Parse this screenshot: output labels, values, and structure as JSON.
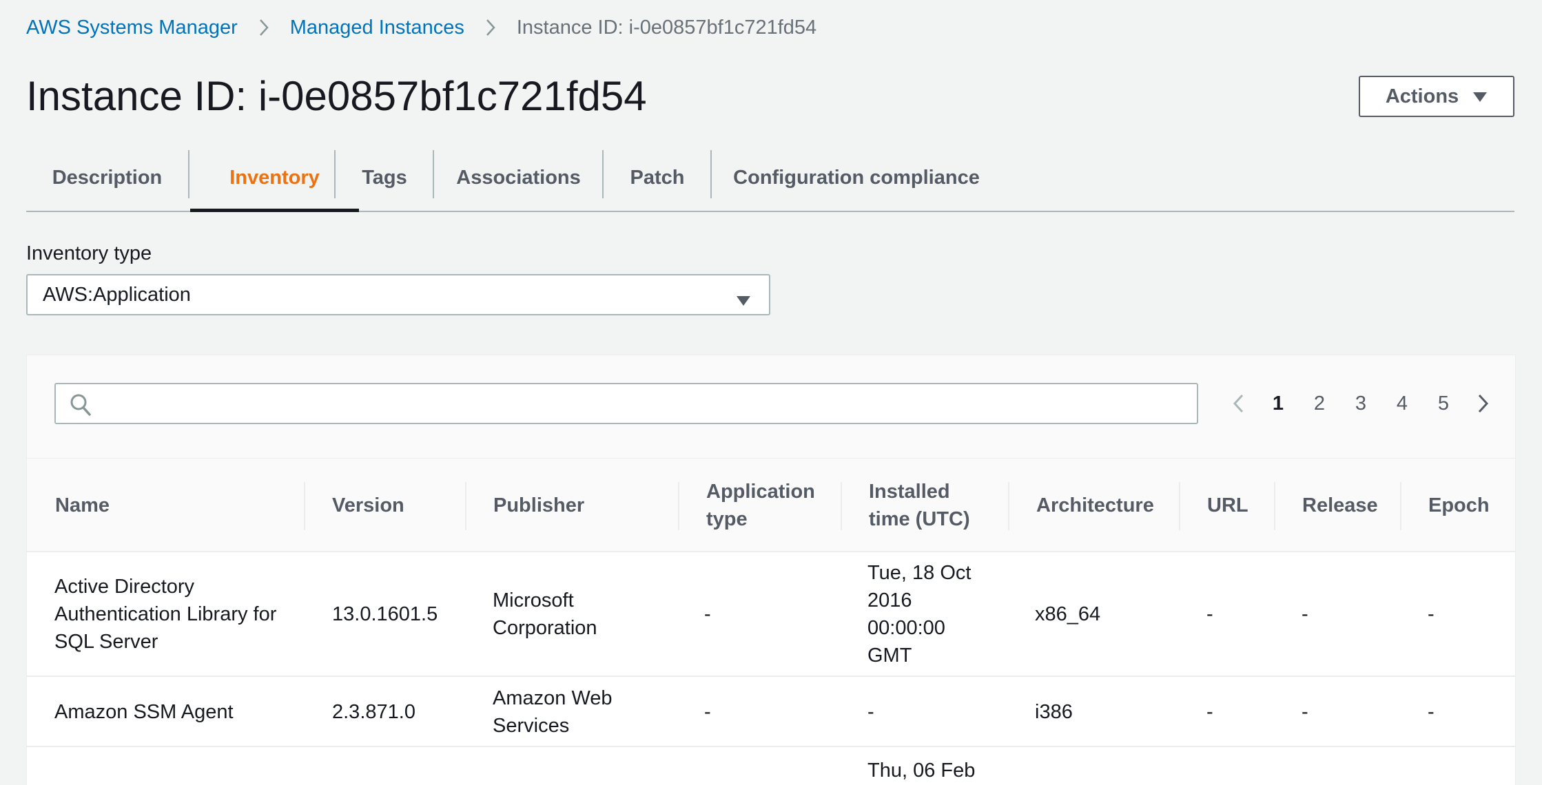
{
  "breadcrumb": {
    "items": [
      "AWS Systems Manager",
      "Managed Instances"
    ],
    "current": "Instance ID: i-0e0857bf1c721fd54"
  },
  "page": {
    "title": "Instance ID: i-0e0857bf1c721fd54",
    "actions_label": "Actions"
  },
  "tabs": [
    "Description",
    "Inventory",
    "Tags",
    "Associations",
    "Patch",
    "Configuration compliance"
  ],
  "active_tab": "Inventory",
  "inventory": {
    "label": "Inventory type",
    "selected": "AWS:Application"
  },
  "search": {
    "placeholder": "",
    "value": ""
  },
  "pagination": {
    "pages": [
      "1",
      "2",
      "3",
      "4",
      "5"
    ],
    "current": "1"
  },
  "table": {
    "columns": [
      "Name",
      "Version",
      "Publisher",
      "Application type",
      "Installed time (UTC)",
      "Architecture",
      "URL",
      "Release",
      "Epoch"
    ],
    "rows": [
      [
        "Active Directory Authentication Library for SQL Server",
        "13.0.1601.5",
        "Microsoft Corporation",
        "-",
        "Tue, 18 Oct 2016 00:00:00 GMT",
        "x86_64",
        "-",
        "-",
        "-"
      ],
      [
        "Amazon SSM Agent",
        "2.3.871.0",
        "Amazon Web Services",
        "-",
        "-",
        "i386",
        "-",
        "-",
        "-"
      ],
      [
        "",
        "",
        "",
        "",
        "Thu, 06 Feb",
        "",
        "",
        "",
        ""
      ]
    ]
  },
  "colors": {
    "link": "#0073bb",
    "active_tab": "#ec7211",
    "background": "#f2f3f3"
  },
  "icons": {
    "breadcrumb_separator": "chevron-right-icon",
    "actions": "caret-down-icon",
    "select": "caret-down-icon",
    "search": "search-icon",
    "prev": "chevron-left-icon",
    "next": "chevron-right-icon"
  }
}
